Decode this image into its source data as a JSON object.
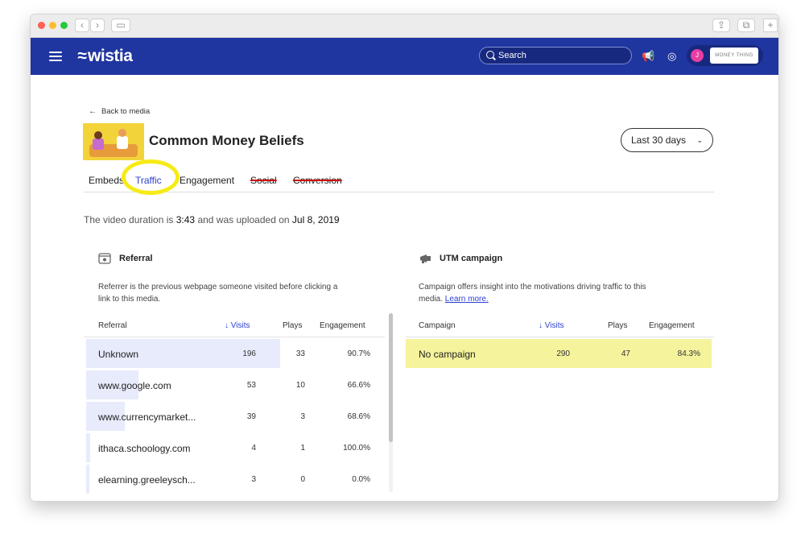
{
  "browser": {
    "controls": [
      "‹",
      "›"
    ],
    "sidebar_toggle": "▭",
    "right_controls": [
      "⇪",
      "⧉"
    ],
    "new_tab": "+"
  },
  "appbar": {
    "logo": "wistia",
    "search_placeholder": "Search",
    "avatar_initial": "J",
    "account_name": "MONEY THING"
  },
  "header": {
    "back_label": "Back to media",
    "title": "Common Money Beliefs",
    "date_range": "Last 30 days"
  },
  "tabs": [
    {
      "label": "Embeds",
      "active": false,
      "struck": false
    },
    {
      "label": "Traffic",
      "active": true,
      "struck": false
    },
    {
      "label": "Engagement",
      "active": false,
      "struck": false
    },
    {
      "label": "Social",
      "active": false,
      "struck": true
    },
    {
      "label": "Conversion",
      "active": false,
      "struck": true
    }
  ],
  "summary": {
    "prefix": "The video duration is",
    "duration": "3:43",
    "middle": "and was uploaded on",
    "date": "Jul 8, 2019"
  },
  "referral": {
    "title": "Referral",
    "desc_line1": "Referrer is the previous webpage someone visited before clicking a",
    "desc_line2": "link to this media.",
    "columns": [
      "Referral",
      "↓ Visits",
      "Plays",
      "Engagement"
    ],
    "max_visits": 196,
    "rows": [
      {
        "name": "Unknown",
        "visits": "196",
        "plays": "33",
        "engagement": "90.7%",
        "visits_num": 196
      },
      {
        "name": "www.google.com",
        "visits": "53",
        "plays": "10",
        "engagement": "66.6%",
        "visits_num": 53
      },
      {
        "name": "www.currencymarket...",
        "visits": "39",
        "plays": "3",
        "engagement": "68.6%",
        "visits_num": 39
      },
      {
        "name": "ithaca.schoology.com",
        "visits": "4",
        "plays": "1",
        "engagement": "100.0%",
        "visits_num": 4
      },
      {
        "name": "elearning.greeleysch...",
        "visits": "3",
        "plays": "0",
        "engagement": "0.0%",
        "visits_num": 3
      }
    ]
  },
  "utm": {
    "title": "UTM campaign",
    "desc_line1": "Campaign offers insight into the motivations driving traffic to this",
    "desc_line2_prefix": "media.",
    "learn_more": "Learn more.",
    "columns": [
      "Campaign",
      "↓ Visits",
      "Plays",
      "Engagement"
    ],
    "rows": [
      {
        "name": "No campaign",
        "visits": "290",
        "plays": "47",
        "engagement": "84.3%"
      }
    ]
  },
  "colors": {
    "appbar": "#1f35a0",
    "accent": "#2b3fd0",
    "highlight": "#f6eb16",
    "row_bar": "#e7ebfb"
  }
}
